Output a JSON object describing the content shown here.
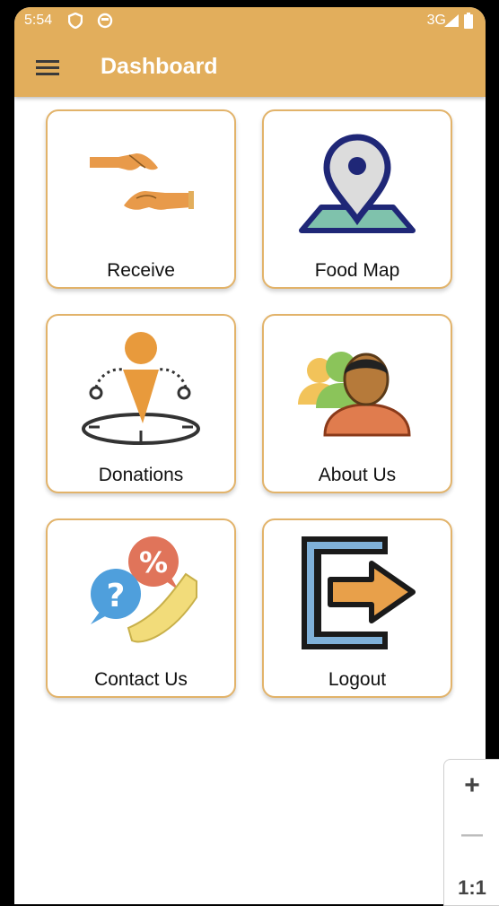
{
  "status": {
    "time": "5:54",
    "network": "3G"
  },
  "appbar": {
    "title": "Dashboard"
  },
  "cards": [
    {
      "label": "Receive",
      "icon": "handshake-icon"
    },
    {
      "label": "Food Map",
      "icon": "map-pin-icon"
    },
    {
      "label": "Donations",
      "icon": "person-location-icon"
    },
    {
      "label": "About Us",
      "icon": "group-icon"
    },
    {
      "label": "Contact Us",
      "icon": "phone-chat-icon"
    },
    {
      "label": "Logout",
      "icon": "logout-icon"
    }
  ],
  "zoom": {
    "in_label": "+",
    "out_label": "—",
    "reset_label": "1:1"
  },
  "colors": {
    "appbar": "#e2ae5c",
    "card_border": "#e2b36a",
    "map_pin": "#1f2777"
  }
}
